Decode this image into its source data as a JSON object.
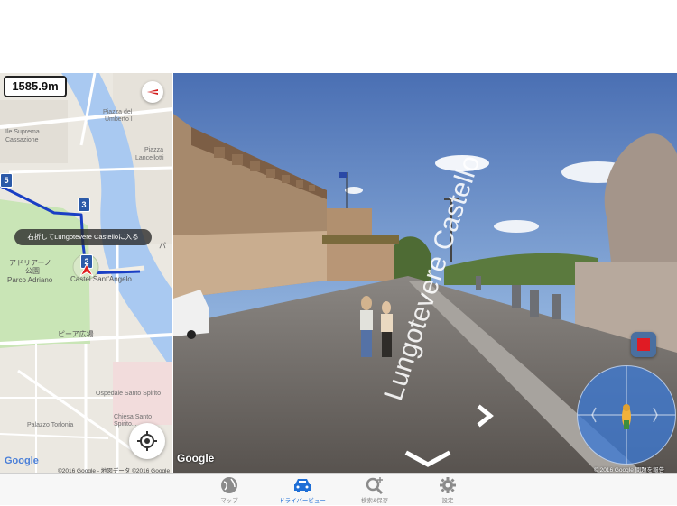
{
  "map": {
    "distance": "1585.9m",
    "labels": {
      "l1": "Piazza del",
      "l2": "Umberto I",
      "l3": "Ile Suprema",
      "l4": "Cassazione",
      "l5": "Piazza",
      "l6": "Lancellotti",
      "l7": "アドリアーノ",
      "l8": "公園",
      "l9": "Parco Adriano",
      "l10": "Castel Sant'Angelo",
      "l11": "ピーア広場",
      "l12": "Ospedale Santo Spirito",
      "l13": "Palazzo Torlonia",
      "l14": "Chiesa Santo",
      "l15": "Spirito...",
      "l16": "パ"
    },
    "route_markers": [
      "5",
      "3",
      "2"
    ],
    "tooltip": "右折してLungotevere Castelloに入る",
    "google_logo": "Google",
    "copyright": "©2016 Google - 地図データ ©2016 Google"
  },
  "street_view": {
    "road_label": "Lungotevere Castello",
    "google_logo": "Google",
    "copyright": "© 2016 Google   問題を報告"
  },
  "tabs": [
    {
      "label": "マップ",
      "icon": "globe-icon",
      "active": false
    },
    {
      "label": "ドライバービュー",
      "icon": "car-icon",
      "active": true
    },
    {
      "label": "検索&保存",
      "icon": "search-plus-icon",
      "active": false
    },
    {
      "label": "設定",
      "icon": "gear-icon",
      "active": false
    }
  ],
  "colors": {
    "accent": "#1f6fd6",
    "route": "#1a3fc4",
    "river": "#a8c8f0",
    "park": "#c5e3b3",
    "stop": "#e01b24"
  }
}
